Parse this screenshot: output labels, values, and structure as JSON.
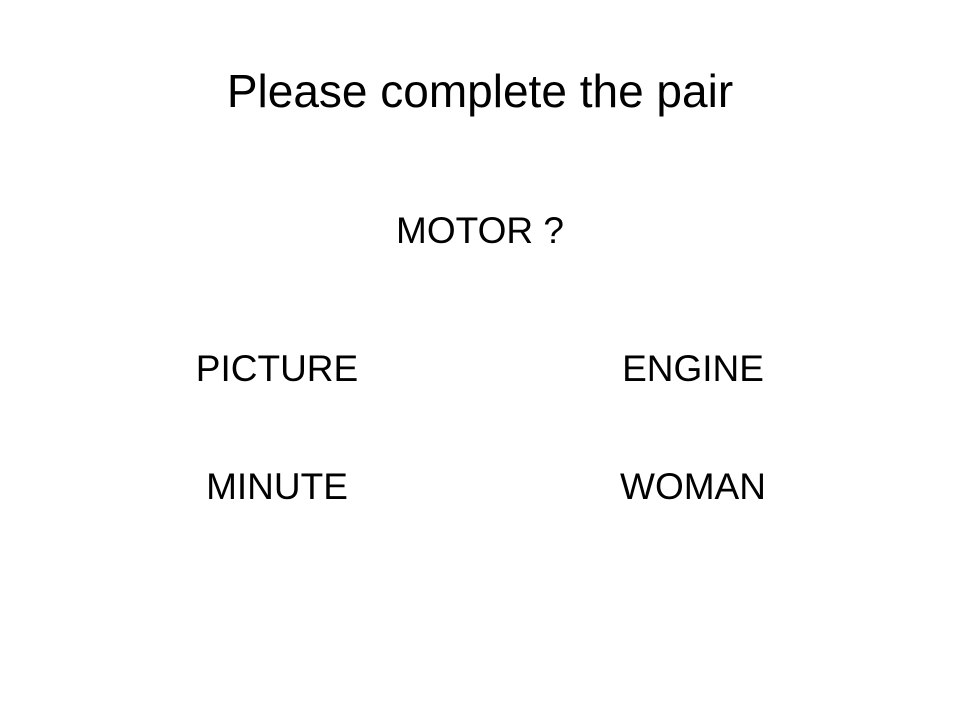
{
  "slide": {
    "title": "Please complete the pair",
    "prompt": "MOTOR ?",
    "options": [
      "PICTURE",
      "ENGINE",
      "MINUTE",
      "WOMAN"
    ]
  }
}
